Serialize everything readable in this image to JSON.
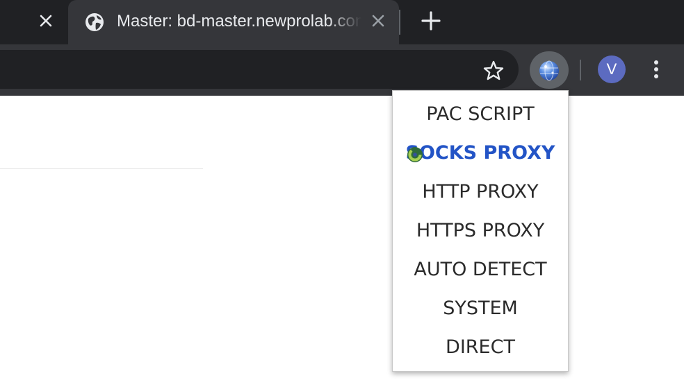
{
  "tabs": [
    {
      "title": "",
      "close_icon": "close-icon"
    },
    {
      "title": "Master: bd-master.newprolab.com",
      "favicon": "globe-icon",
      "close_icon": "close-icon",
      "active": true
    }
  ],
  "tabstrip": {
    "new_tab_icon": "plus-icon"
  },
  "toolbar": {
    "bookmark_icon": "star-icon",
    "extension_icon": "proxy-globe-icon",
    "avatar_letter": "V",
    "menu_icon": "kebab-menu-icon"
  },
  "proxy_menu": {
    "items": [
      {
        "label": "PAC SCRIPT",
        "selected": false
      },
      {
        "label": "SOCKS PROXY",
        "selected": true
      },
      {
        "label": "HTTP PROXY",
        "selected": false
      },
      {
        "label": "HTTPS PROXY",
        "selected": false
      },
      {
        "label": "AUTO DETECT",
        "selected": false
      },
      {
        "label": "SYSTEM",
        "selected": false
      },
      {
        "label": "DIRECT",
        "selected": false
      }
    ],
    "active_indicator_icon": "loading-spinner-icon"
  },
  "colors": {
    "tabstrip_bg": "#202124",
    "toolbar_bg": "#35363a",
    "active_item": "#2354c6",
    "avatar_bg": "#5c6bc0"
  }
}
